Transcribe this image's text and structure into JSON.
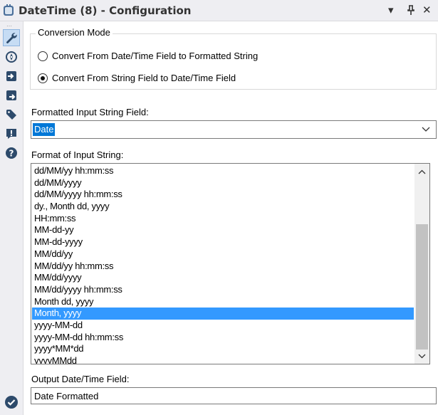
{
  "window": {
    "title": "DateTime (8) - Configuration",
    "controls": {
      "dropdown": "▾",
      "pin": "ꟸ",
      "close": "✕"
    }
  },
  "toolbar": {
    "icons": [
      "wrench-icon",
      "compass-icon",
      "input-arrow-icon",
      "output-arrow-icon",
      "tag-icon",
      "alert-icon",
      "help-icon"
    ],
    "active": "wrench-icon",
    "ok_icon": "checkmark-circle-icon",
    "accent": "#2d4a6b"
  },
  "conversion_mode": {
    "legend": "Conversion Mode",
    "options": [
      {
        "label": "Convert From Date/Time Field to Formatted String",
        "selected": false
      },
      {
        "label": "Convert From String Field to Date/Time Field",
        "selected": true
      }
    ]
  },
  "input_field": {
    "label": "Formatted Input String Field:",
    "value": "Date"
  },
  "format": {
    "label": "Format of Input String:",
    "items": [
      "dd/MM/yy hh:mm:ss",
      "dd/MM/yyyy",
      "dd/MM/yyyy hh:mm:ss",
      "dy., Month dd, yyyy",
      "HH:mm:ss",
      "MM-dd-yy",
      "MM-dd-yyyy",
      "MM/dd/yy",
      "MM/dd/yy hh:mm:ss",
      "MM/dd/yyyy",
      "MM/dd/yyyy hh:mm:ss",
      "Month dd, yyyy",
      "Month, yyyy",
      "yyyy-MM-dd",
      "yyyy-MM-dd hh:mm:ss",
      "yyyy*MM*dd",
      "yyyyMMdd"
    ],
    "selected_index": 12
  },
  "output_field": {
    "label": "Output Date/Time Field:",
    "value": "Date Formatted"
  },
  "colors": {
    "selection": "#3399ff",
    "select_highlight": "#0078d7",
    "panel_bg": "#eeeef2"
  }
}
